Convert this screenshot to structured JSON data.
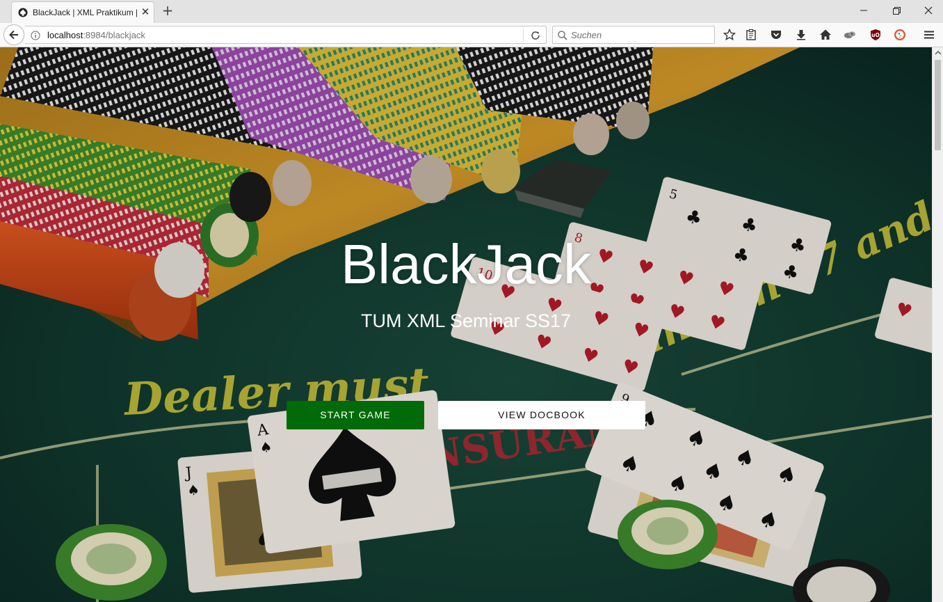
{
  "browser": {
    "tab": {
      "title": "BlackJack | XML Praktikum |",
      "favicon": "poker-suit-icon"
    },
    "address": {
      "host": "localhost",
      "path": ":8984/blackjack"
    },
    "search": {
      "placeholder": "Suchen"
    },
    "toolbar_icons": [
      "bookmark-star-icon",
      "reading-list-icon",
      "pocket-icon",
      "download-icon",
      "home-icon",
      "extension-icon",
      "ublock-icon",
      "duckduckgo-icon",
      "menu-icon"
    ]
  },
  "hero": {
    "title": "BlackJack",
    "subtitle": "TUM XML Seminar SS17",
    "start_label": "START GAME",
    "docbook_label": "VIEW DOCBOOK"
  },
  "colors": {
    "felt": "#10332b",
    "start_button": "#006b08",
    "table_text": "#c9c23a"
  }
}
